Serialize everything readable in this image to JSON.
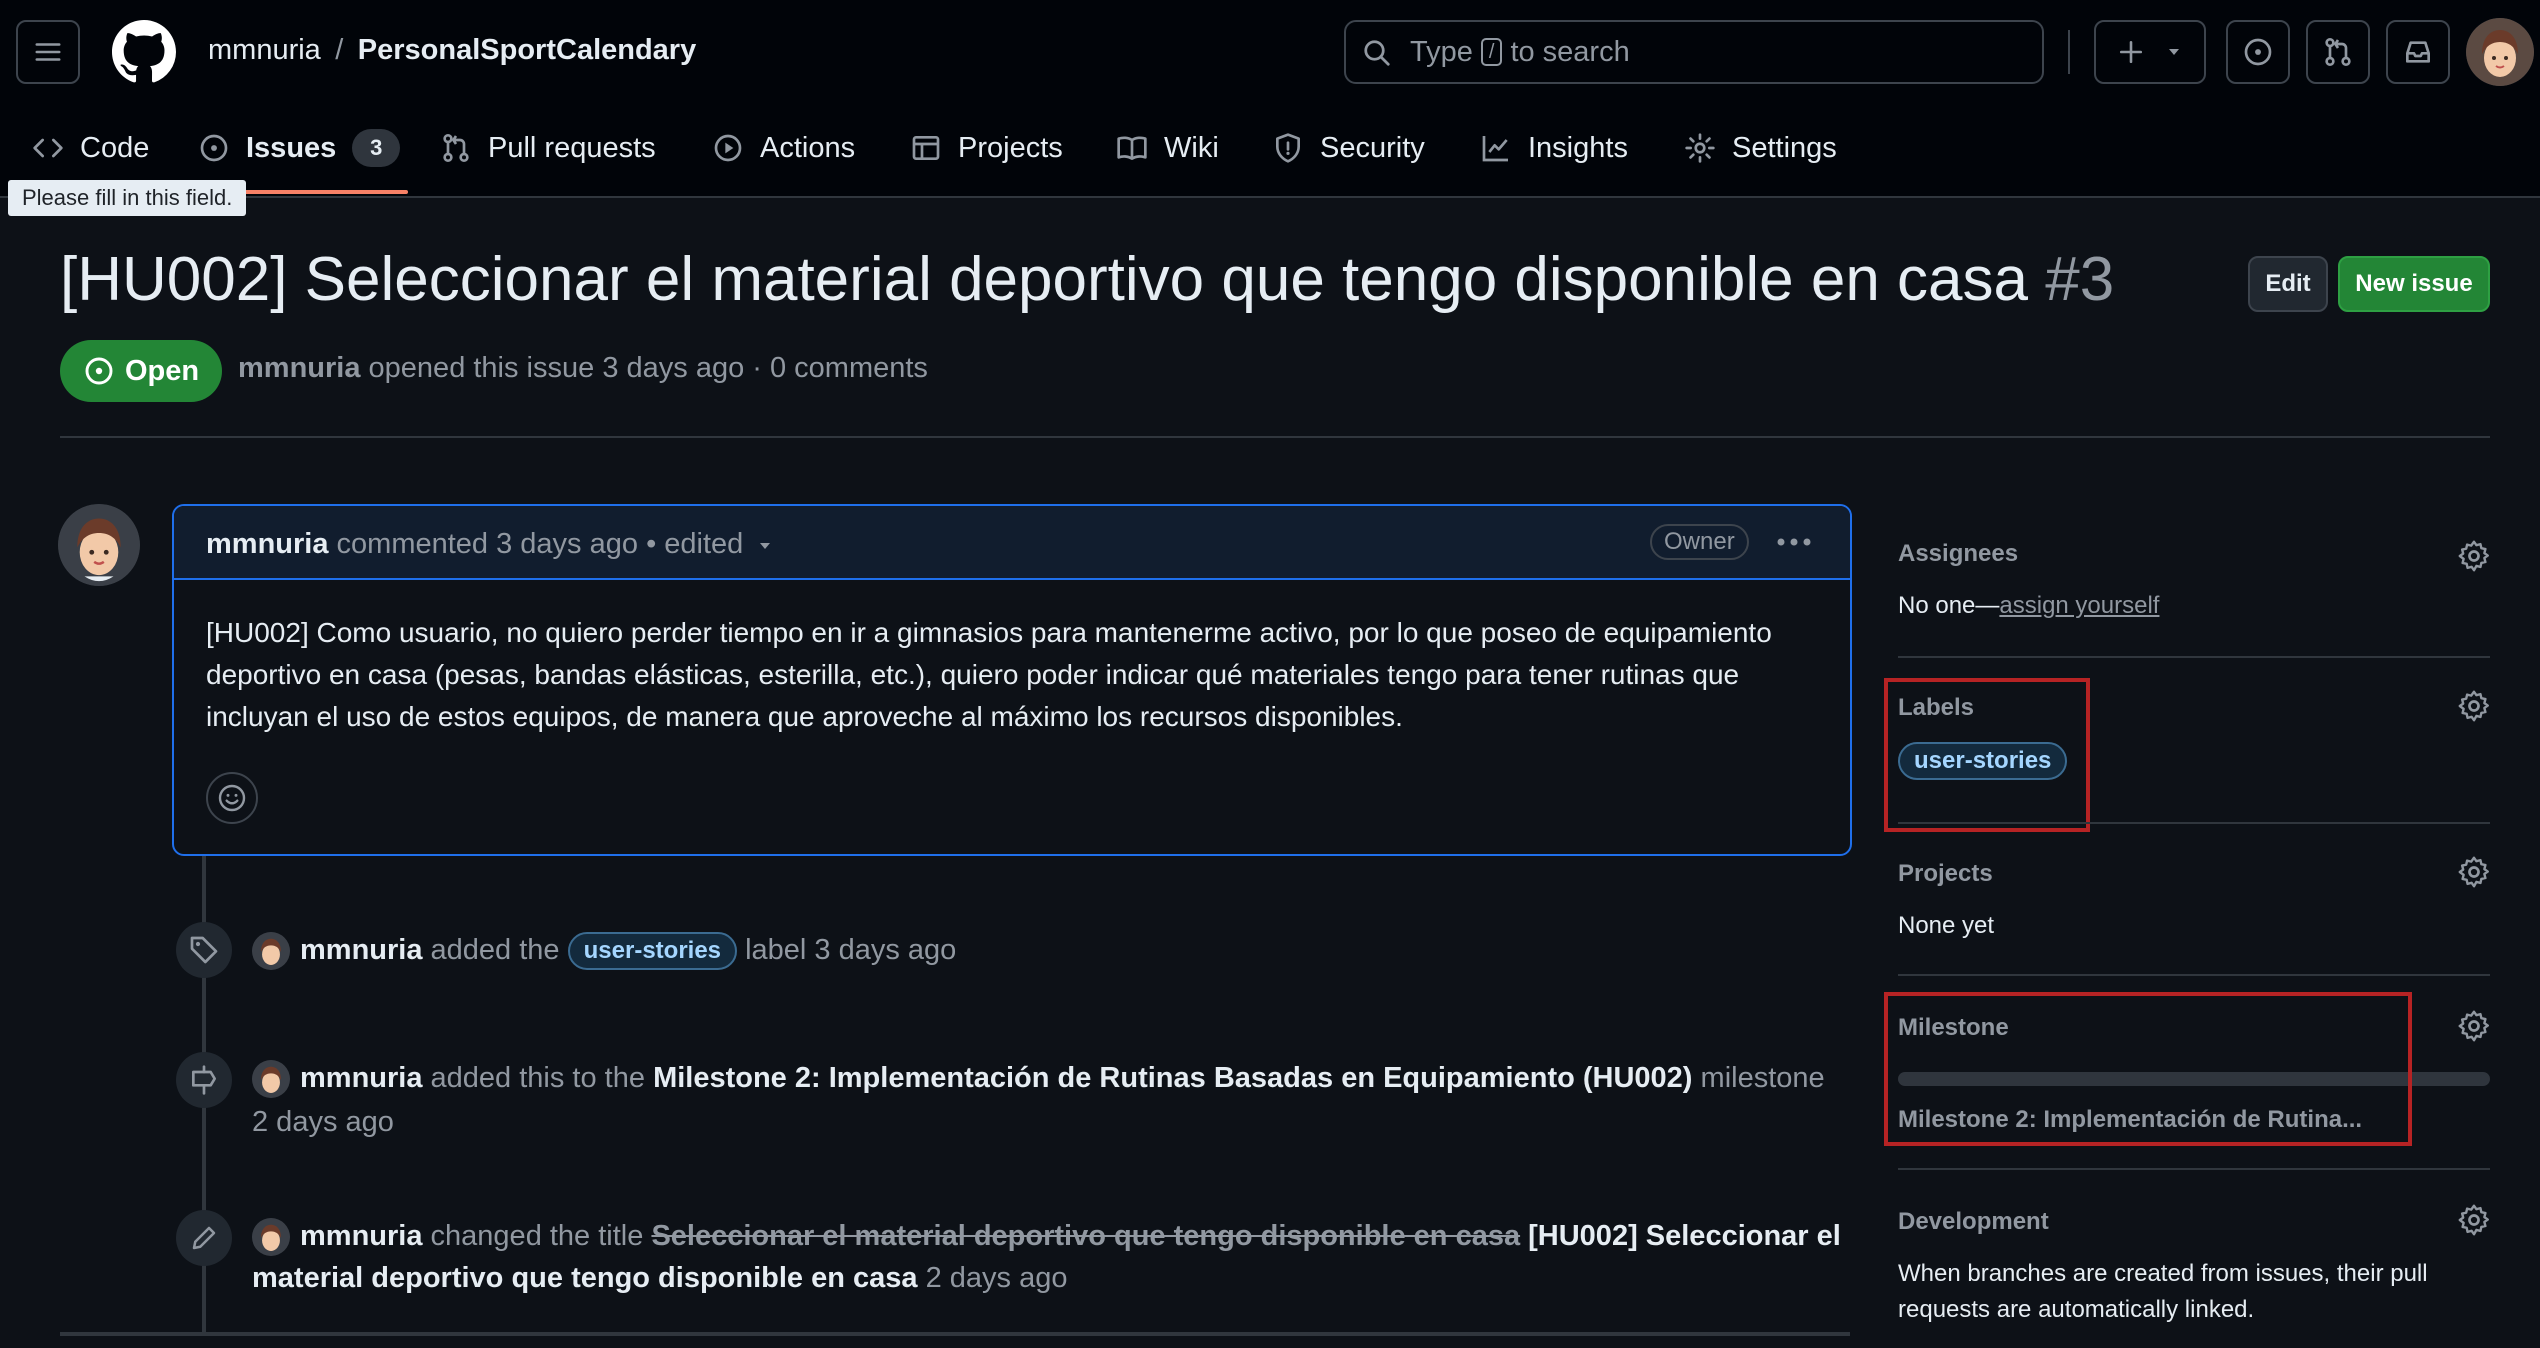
{
  "header": {
    "owner": "mmnuria",
    "separator": "/",
    "repo": "PersonalSportCalendary",
    "search": {
      "prefix": "Type",
      "key": "/",
      "suffix": "to search"
    }
  },
  "tabs": [
    {
      "label": "Code",
      "icon": "code-icon"
    },
    {
      "label": "Issues",
      "icon": "issue-opened-icon",
      "counter": "3",
      "selected": true
    },
    {
      "label": "Pull requests",
      "icon": "git-pull-request-icon"
    },
    {
      "label": "Actions",
      "icon": "play-icon"
    },
    {
      "label": "Projects",
      "icon": "table-icon"
    },
    {
      "label": "Wiki",
      "icon": "book-icon"
    },
    {
      "label": "Security",
      "icon": "shield-icon"
    },
    {
      "label": "Insights",
      "icon": "graph-icon"
    },
    {
      "label": "Settings",
      "icon": "gear-icon"
    }
  ],
  "tooltip": "Please fill in this field.",
  "issue": {
    "title": "[HU002] Seleccionar el material deportivo que tengo disponible en casa",
    "number": "#3",
    "edit_label": "Edit",
    "new_issue_label": "New issue",
    "state": "Open",
    "author": "mmnuria",
    "meta_text": "opened this issue 3 days ago · 0 comments"
  },
  "comment": {
    "author": "mmnuria",
    "action": "commented 3 days ago",
    "edited": "• edited",
    "role": "Owner",
    "body": "[HU002] Como usuario, no quiero perder tiempo en ir a gimnasios para mantenerme activo, por lo que poseo de equipamiento deportivo en casa (pesas, bandas elásticas, esterilla, etc.), quiero poder indicar qué materiales tengo para tener rutinas que incluyan el uso de estos equipos, de manera que aproveche al máximo los recursos disponibles."
  },
  "timeline": [
    {
      "icon": "tag-icon",
      "author": "mmnuria",
      "pre": "added the",
      "label": "user-stories",
      "post": "label 3 days ago"
    },
    {
      "icon": "milestone-icon",
      "author": "mmnuria",
      "pre": "added this to the",
      "milestone": "Milestone 2: Implementación de Rutinas Basadas en Equipamiento (HU002)",
      "post": "milestone",
      "time": "2 days ago"
    },
    {
      "icon": "pencil-icon",
      "author": "mmnuria",
      "pre": "changed the title",
      "old_title": "Seleccionar el material deportivo que tengo disponible en casa",
      "new_title_a": "[HU002] Seleccionar el",
      "new_title_b": "material deportivo que tengo disponible en casa",
      "time": "2 days ago"
    }
  ],
  "sidebar": {
    "assignees": {
      "heading": "Assignees",
      "value": "No one—",
      "link": "assign yourself"
    },
    "labels": {
      "heading": "Labels",
      "items": [
        "user-stories"
      ]
    },
    "projects": {
      "heading": "Projects",
      "value": "None yet"
    },
    "milestone": {
      "heading": "Milestone",
      "value": "Milestone 2: Implementación de Rutina...",
      "progress": 0
    },
    "development": {
      "heading": "Development",
      "line1": "When branches are created from issues, their pull",
      "line2": "requests are automatically linked."
    }
  },
  "colors": {
    "accent_open": "#238636",
    "label_text": "#a5d6ff",
    "highlight_box": "#b62324",
    "tab_underline": "#f78166"
  }
}
